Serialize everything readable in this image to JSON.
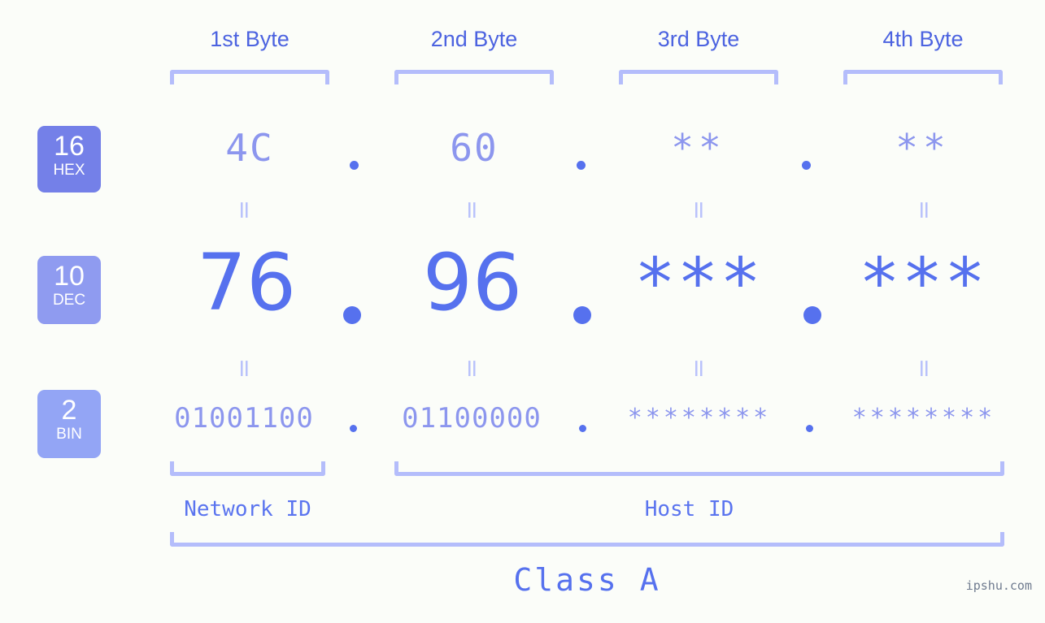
{
  "meta": {
    "background": "#fbfdf9",
    "accent_strong": "#5671ee",
    "accent_mid": "#8c96ee",
    "accent_light": "#b4bdfb"
  },
  "columns": [
    {
      "header": "1st Byte"
    },
    {
      "header": "2nd Byte"
    },
    {
      "header": "3rd Byte"
    },
    {
      "header": "4th Byte"
    }
  ],
  "bases": [
    {
      "number": "16",
      "name": "HEX",
      "color": "#7480e8"
    },
    {
      "number": "10",
      "name": "DEC",
      "color": "#8f9bf0"
    },
    {
      "number": "2",
      "name": "BIN",
      "color": "#93a5f5"
    }
  ],
  "rows": {
    "hex": {
      "values": [
        "4C",
        "60",
        "**",
        "**"
      ]
    },
    "dec": {
      "values": [
        "76",
        "96",
        "***",
        "***"
      ]
    },
    "bin": {
      "values": [
        "01001100",
        "01100000",
        "********",
        "********"
      ]
    }
  },
  "connectors": {
    "equals": "="
  },
  "separators": {
    "dot": "."
  },
  "segments": {
    "network_id": "Network ID",
    "host_id": "Host ID"
  },
  "class_label": "Class A",
  "watermark": "ipshu.com"
}
